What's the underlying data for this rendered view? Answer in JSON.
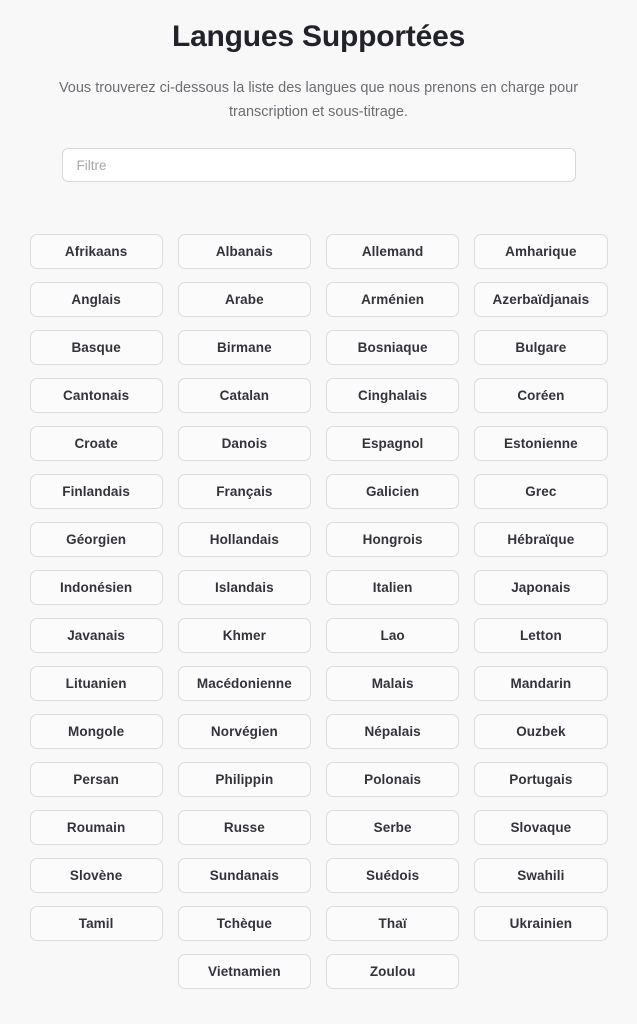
{
  "header": {
    "title": "Langues Supportées",
    "subtitle": "Vous trouverez ci-dessous la liste des langues que nous prenons en charge pour transcription et sous-titrage."
  },
  "filter": {
    "placeholder": "Filtre",
    "value": ""
  },
  "colors": {
    "background": "#f8f8f8",
    "title": "#22222a",
    "subtitle": "#6d6d73",
    "chip_border": "#dcdcdc",
    "chip_background": "#fbfbfb",
    "chip_text": "#33333b",
    "input_border": "#d8d8d8",
    "placeholder": "#a7a7ac"
  },
  "languages": [
    "Afrikaans",
    "Albanais",
    "Allemand",
    "Amharique",
    "Anglais",
    "Arabe",
    "Arménien",
    "Azerbaïdjanais",
    "Basque",
    "Birmane",
    "Bosniaque",
    "Bulgare",
    "Cantonais",
    "Catalan",
    "Cinghalais",
    "Coréen",
    "Croate",
    "Danois",
    "Espagnol",
    "Estonienne",
    "Finlandais",
    "Français",
    "Galicien",
    "Grec",
    "Géorgien",
    "Hollandais",
    "Hongrois",
    "Hébraïque",
    "Indonésien",
    "Islandais",
    "Italien",
    "Japonais",
    "Javanais",
    "Khmer",
    "Lao",
    "Letton",
    "Lituanien",
    "Macédonienne",
    "Malais",
    "Mandarin",
    "Mongole",
    "Norvégien",
    "Népalais",
    "Ouzbek",
    "Persan",
    "Philippin",
    "Polonais",
    "Portugais",
    "Roumain",
    "Russe",
    "Serbe",
    "Slovaque",
    "Slovène",
    "Sundanais",
    "Suédois",
    "Swahili",
    "Tamil",
    "Tchèque",
    "Thaï",
    "Ukrainien",
    "Vietnamien",
    "Zoulou"
  ],
  "language_count": 62
}
